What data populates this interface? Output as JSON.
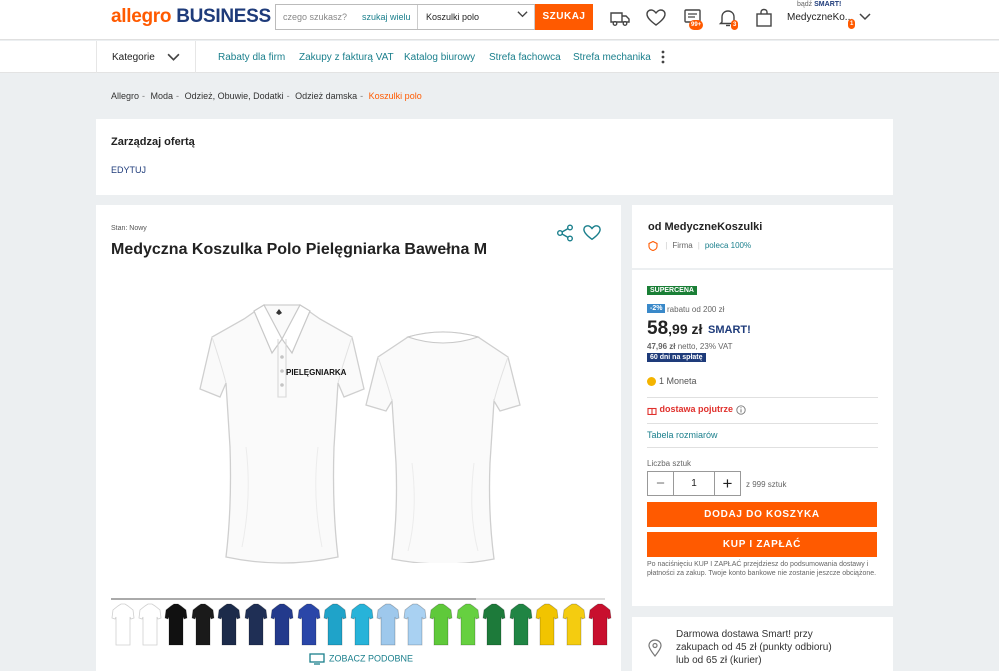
{
  "header": {
    "logo_part1": "allegro",
    "logo_part2": "BUSINESS",
    "search_placeholder": "czego szukasz?",
    "search_scope": "szukaj wielu",
    "category_select": "Koszulki polo",
    "search_button": "SZUKAJ",
    "messages_badge": "99+",
    "notifications_badge": "3",
    "smart_prefix": "bądź",
    "smart_label": "SMART!",
    "account_name": "MedyczneKo...",
    "account_badge": "1"
  },
  "nav": {
    "categories_label": "Kategorie",
    "links": [
      "Rabaty dla firm",
      "Zakupy z fakturą VAT",
      "Katalog biurowy",
      "Strefa fachowca",
      "Strefa mechanika"
    ]
  },
  "breadcrumbs": {
    "items": [
      "Allegro",
      "Moda",
      "Odzież, Obuwie, Dodatki",
      "Odzież damska"
    ],
    "separator": "-",
    "current": "Koszulki polo"
  },
  "manage": {
    "title": "Zarządzaj ofertą",
    "edit_label": "EDYTUJ"
  },
  "product": {
    "condition": "Stan: Nowy",
    "title": "Medyczna Koszulka Polo Pielęgniarka Bawełna M",
    "print_text": "PIELĘGNIARKA",
    "similar_label": "ZOBACZ PODOBNE",
    "gallery_colors": [
      "#ffffff",
      "#ffffff",
      "#111111",
      "#1a1a1a",
      "#1c2b4a",
      "#1f2f55",
      "#233a8c",
      "#2a46a8",
      "#1fa3c9",
      "#27b3d9",
      "#9ec8ec",
      "#a9d1f2",
      "#5fc93a",
      "#66d040",
      "#1d7a3a",
      "#208544",
      "#f1c400",
      "#f4cc10",
      "#c8102e"
    ]
  },
  "seller": {
    "from_label": "od MedyczneKoszulki",
    "type": "Firma",
    "recommend": "poleca 100%"
  },
  "buy": {
    "supercena": "SUPERCENA",
    "discount_badge": "-2%",
    "discount_text": "rabatu od 200 zł",
    "price_main": "58",
    "price_fraction": ",99 zł",
    "smart_label": "SMART!",
    "net_bold": "47,96 zł",
    "net_rest": " netto, 23% VAT",
    "pay_later": "60 dni na spłatę",
    "coins": "1 Moneta",
    "delivery_label": "dostawa pojutrze",
    "size_table": "Tabela rozmiarów",
    "qty_label": "Liczba sztuk",
    "qty_value": "1",
    "qty_of": "z 999 sztuk",
    "add_to_cart": "DODAJ DO KOSZYKA",
    "buy_now": "KUP I ZAPŁAĆ",
    "note": "Po naciśnięciu KUP I ZAPŁAĆ przejdziesz do podsumowania dostawy i płatności za zakup. Twoje konto bankowe nie zostanie jeszcze obciążone."
  },
  "delivery_info": {
    "text": "Darmowa dostawa Smart! przy zakupach od 45 zł (punkty odbioru) lub od 65 zł (kurier)"
  },
  "colors": {
    "accent": "#ff5a00",
    "brand_navy": "#1e3b7a",
    "link_teal": "#1a7f8c",
    "supercena_green": "#1a7f36"
  }
}
